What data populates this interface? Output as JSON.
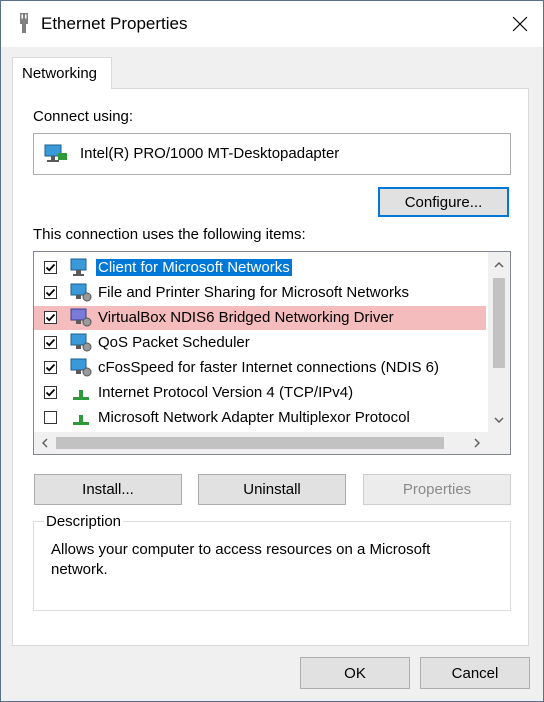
{
  "window": {
    "title": "Ethernet Properties"
  },
  "tabs": [
    {
      "label": "Networking"
    }
  ],
  "connect_using": {
    "label": "Connect using:",
    "adapter_name": "Intel(R) PRO/1000 MT-Desktopadapter"
  },
  "buttons": {
    "configure": "Configure...",
    "install": "Install...",
    "uninstall": "Uninstall",
    "properties": "Properties",
    "ok": "OK",
    "cancel": "Cancel"
  },
  "items_label": "This connection uses the following items:",
  "items": [
    {
      "label": "Client for Microsoft Networks",
      "checked": true,
      "icon": "network-client-icon",
      "state": "selected"
    },
    {
      "label": "File and Printer Sharing for Microsoft Networks",
      "checked": true,
      "icon": "network-service-icon",
      "state": "normal"
    },
    {
      "label": "VirtualBox NDIS6 Bridged Networking Driver",
      "checked": true,
      "icon": "network-driver-icon",
      "state": "highlighted"
    },
    {
      "label": "QoS Packet Scheduler",
      "checked": true,
      "icon": "network-service-icon",
      "state": "normal"
    },
    {
      "label": "cFosSpeed for faster Internet connections (NDIS 6)",
      "checked": true,
      "icon": "network-service-icon",
      "state": "normal"
    },
    {
      "label": "Internet Protocol Version 4 (TCP/IPv4)",
      "checked": true,
      "icon": "protocol-icon",
      "state": "normal"
    },
    {
      "label": "Microsoft Network Adapter Multiplexor Protocol",
      "checked": false,
      "icon": "protocol-icon",
      "state": "normal"
    }
  ],
  "description": {
    "label": "Description",
    "text": "Allows your computer to access resources on a Microsoft network."
  },
  "colors": {
    "selection": "#0078d7",
    "highlight_row": "#f4bcbc",
    "accent": "#0078d7"
  }
}
